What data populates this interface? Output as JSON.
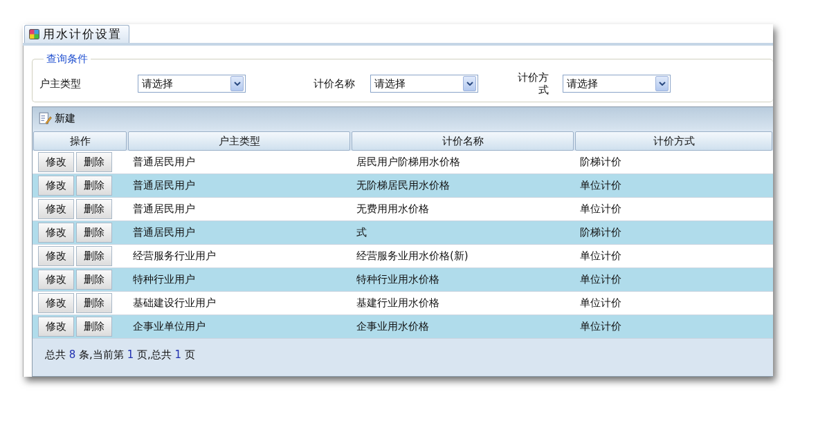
{
  "tab": {
    "label": "用水计价设置",
    "selected": true
  },
  "query": {
    "legend": "查询条件",
    "fields": [
      {
        "label": "户主类型",
        "value": "请选择"
      },
      {
        "label": "计价名称",
        "value": "请选择"
      },
      {
        "label": "计价方式",
        "value": "请选择"
      }
    ]
  },
  "toolbar": {
    "new_button": "新建"
  },
  "table": {
    "columns": [
      "操作",
      "户主类型",
      "计价名称",
      "计价方式"
    ],
    "rows": [
      {
        "actions": [
          "修改",
          "删除"
        ],
        "cells": [
          "普通居民用户",
          "居民用户阶梯用水价格",
          "阶梯计价"
        ]
      },
      {
        "actions": [
          "修改",
          "删除"
        ],
        "cells": [
          "普通居民用户",
          "无阶梯居民用水价格",
          "单位计价"
        ]
      },
      {
        "actions": [
          "修改",
          "删除"
        ],
        "cells": [
          "普通居民用户",
          "无费用用水价格",
          "单位计价"
        ]
      },
      {
        "actions": [
          "修改",
          "删除"
        ],
        "cells": [
          "普通居民用户",
          "式",
          "阶梯计价"
        ]
      },
      {
        "actions": [
          "修改",
          "删除"
        ],
        "cells": [
          "经营服务行业用户",
          "经营服务业用水价格(新)",
          "单位计价"
        ]
      },
      {
        "actions": [
          "修改",
          "删除"
        ],
        "cells": [
          "特种行业用户",
          "特种行业用水价格",
          "单位计价"
        ]
      },
      {
        "actions": [
          "修改",
          "删除"
        ],
        "cells": [
          "基础建设行业用户",
          "基建行业用水价格",
          "单位计价"
        ]
      },
      {
        "actions": [
          "修改",
          "删除"
        ],
        "cells": [
          "企事业单位用户",
          "企事业用水价格",
          "单位计价"
        ]
      }
    ]
  },
  "pager": [
    {
      "kind": "text",
      "text": "总共 "
    },
    {
      "kind": "number",
      "text": "8"
    },
    {
      "kind": "text",
      "text": " 条,当前第 "
    },
    {
      "kind": "number",
      "text": "1"
    },
    {
      "kind": "text",
      "text": " 页,总共 "
    },
    {
      "kind": "number",
      "text": "1"
    },
    {
      "kind": "text",
      "text": " 页"
    }
  ]
}
